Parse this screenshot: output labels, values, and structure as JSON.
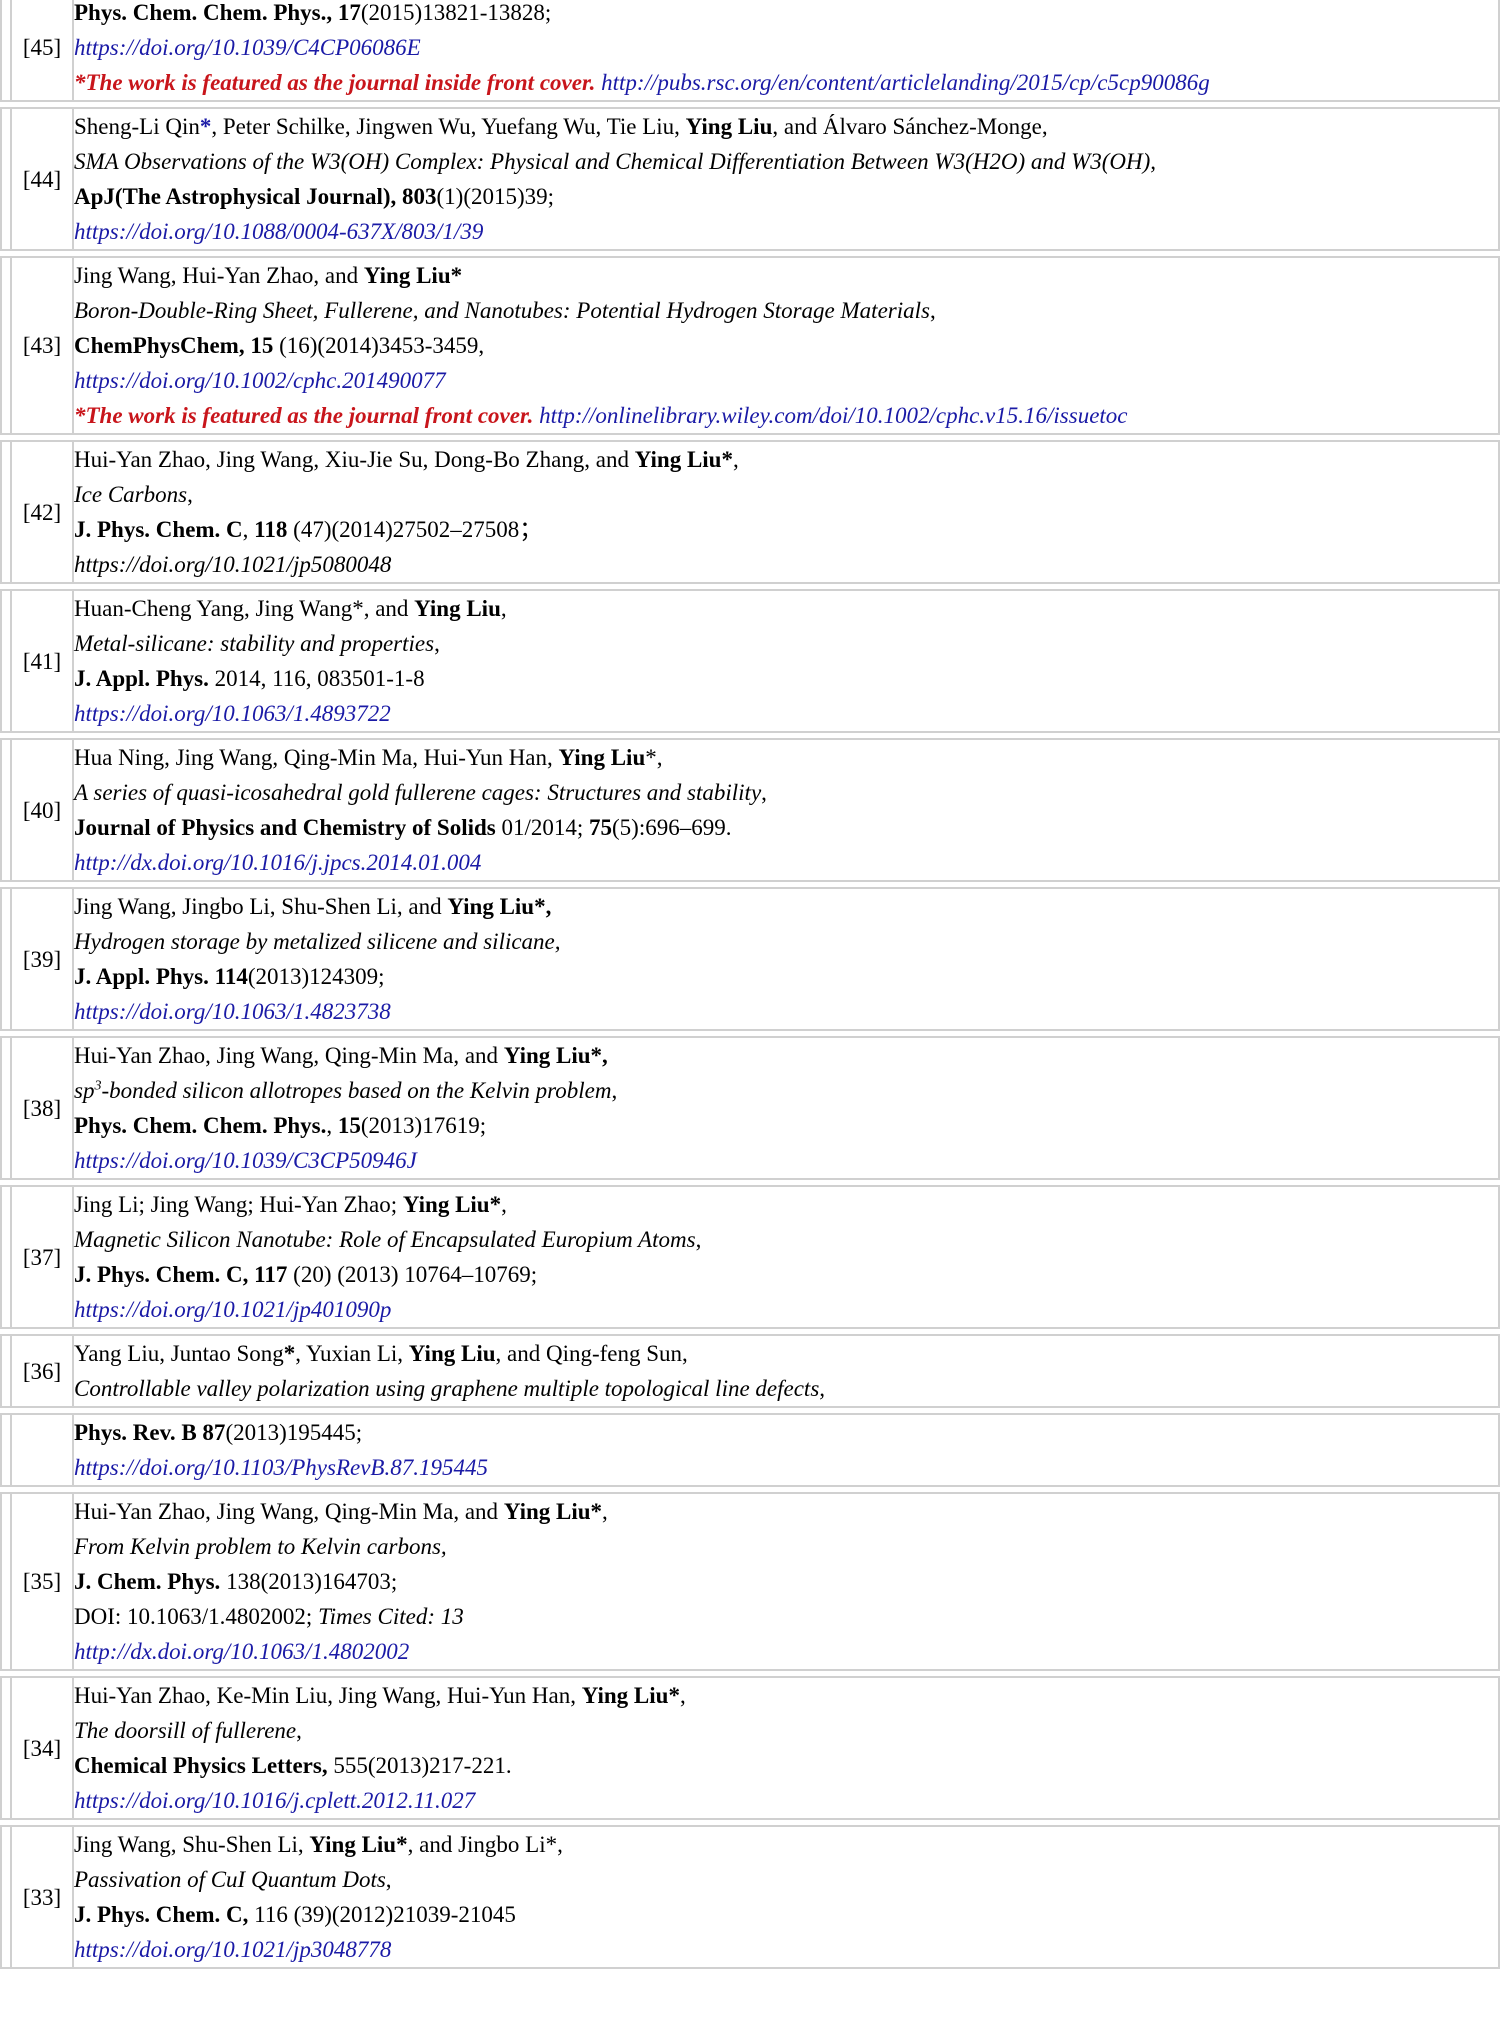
{
  "entries": {
    "e45": {
      "number": "[45]",
      "cut_text": "",
      "journal": "Phys. Chem. Chem. Phys., 17",
      "citation": "(2015)13821-13828;",
      "doi": "https://doi.org/10.1039/C4CP06086E",
      "feature_note": "*The work is featured as the journal inside front cover.",
      "feature_link": "http://pubs.rsc.org/en/content/articlelanding/2015/cp/c5cp90086g"
    },
    "e44": {
      "number": "[44]",
      "authors_pre": "Sheng-Li Qin",
      "authors_star": "*",
      "authors_mid": ", Peter Schilke, Jingwen Wu, Yuefang Wu, Tie Liu, ",
      "highlight": "Ying Liu",
      "authors_post": ", and Álvaro Sánchez-Monge,",
      "title": "SMA Observations of the W3(OH) Complex: Physical and Chemical Differentiation Between W3(H2O) and W3(OH),",
      "journal": "ApJ(The Astrophysical Journal), 803",
      "citation": "(1)(2015)39;",
      "doi": "https://doi.org/10.1088/0004-637X/803/1/39"
    },
    "e43": {
      "number": "[43]",
      "authors": "Jing Wang, Hui-Yan Zhao, and ",
      "highlight": "Ying Liu*",
      "title": "Boron-Double-Ring Sheet, Fullerene, and Nanotubes: Potential Hydrogen Storage Materials",
      "title_tail": ",",
      "journal": "ChemPhysChem, 15",
      "citation": " (16)(2014)3453-3459,",
      "doi": "https://doi.org/10.1002/cphc.201490077",
      "feature_note": "*The work is featured as the journal front cover.",
      "feature_link": "http://onlinelibrary.wiley.com/doi/10.1002/cphc.v15.16/issuetoc"
    },
    "e42": {
      "number": "[42]",
      "authors": "Hui-Yan Zhao, Jing Wang, Xiu-Jie Su, Dong-Bo Zhang, and ",
      "highlight": "Ying Liu*",
      "authors_post": ",",
      "title": "Ice Carbons",
      "title_tail": ",",
      "journal_a": "J. Phys. Chem. C",
      "sep": ", ",
      "journal_b": "118",
      "citation": " (47)(2014)27502–27508；",
      "doi": "https://doi.org/10.1021/jp5080048"
    },
    "e41": {
      "number": "[41]",
      "authors": "Huan-Cheng Yang, Jing Wang*, and ",
      "highlight": "Ying Liu",
      "authors_post": ",",
      "title": "Metal-silicane: stability and properties",
      "title_tail": ",",
      "journal": "J. Appl. Phys.",
      "citation": " 2014, 116, 083501-1-8",
      "doi": "https://doi.org/10.1063/1.4893722"
    },
    "e40": {
      "number": "[40]",
      "authors": "Hua Ning, Jing Wang, Qing-Min Ma, Hui-Yun Han, ",
      "highlight": "Ying Liu",
      "authors_post": "*,",
      "title": "A series of quasi-icosahedral gold fullerene cages: Structures and stability",
      "title_tail": ",",
      "journal": "Journal of Physics and Chemistry of Solids",
      "citation_a": " 01/2014; ",
      "volume": "75",
      "citation_b": "(5):696–699.",
      "doi": "http://dx.doi.org/10.1016/j.jpcs.2014.01.004"
    },
    "e39": {
      "number": "[39]",
      "authors": "Jing Wang, Jingbo Li, Shu-Shen Li, and ",
      "highlight": "Ying Liu*,",
      "title": "Hydrogen storage by metalized silicene and silicane,",
      "journal": "J. Appl. Phys. 114",
      "citation": "(2013)124309;",
      "doi": "https://doi.org/10.1063/1.4823738"
    },
    "e38": {
      "number": "[38]",
      "authors": "Hui-Yan Zhao, Jing Wang, Qing-Min Ma, and ",
      "highlight": "Ying Liu*,",
      "title_a": "sp",
      "title_sup": "3",
      "title_b": "-bonded silicon allotropes based on the Kelvin problem",
      "title_tail": ",",
      "journal": "Phys. Chem. Chem. Phys.",
      "sep": ", ",
      "volume": "15",
      "citation": "(2013)17619;",
      "doi": "https://doi.org/10.1039/C3CP50946J"
    },
    "e37": {
      "number": "[37]",
      "authors": "Jing Li; Jing Wang; Hui-Yan Zhao; ",
      "highlight": "Ying Liu*",
      "authors_post": ",",
      "title": "Magnetic Silicon Nanotube: Role of Encapsulated Europium Atoms",
      "title_tail": ",",
      "journal": "J. Phys. Chem. C, 117",
      "citation": " (20) (2013) 10764–10769;",
      "doi": "https://doi.org/10.1021/jp401090p"
    },
    "e36": {
      "number": "[36]",
      "authors_pre": "Yang Liu, Juntao Song",
      "authors_star": "*",
      "authors_mid": ", Yuxian Li, ",
      "highlight": "Ying Liu",
      "authors_post": ", and Qing-feng Sun,",
      "title": "Controllable valley polarization using graphene multiple topological line defects,"
    },
    "e36b": {
      "number": "",
      "journal": "Phys. Rev. B 87",
      "citation": "(2013)195445;",
      "doi": "https://doi.org/10.1103/PhysRevB.87.195445"
    },
    "e35": {
      "number": "[35]",
      "authors": "Hui-Yan Zhao, Jing Wang, Qing-Min Ma, and ",
      "highlight": "Ying Liu*",
      "authors_post": ",",
      "title": "From Kelvin problem to Kelvin carbons,",
      "journal": "J. Chem. Phys.",
      "citation": " 138(2013)164703;",
      "doi_text": "DOI: 10.1063/1.4802002; ",
      "times_cited": "Times Cited: 13",
      "doi": "http://dx.doi.org/10.1063/1.4802002"
    },
    "e34": {
      "number": "[34]",
      "authors": "Hui-Yan Zhao, Ke-Min Liu, Jing Wang, Hui-Yun Han, ",
      "highlight": "Ying Liu*",
      "authors_post": ",",
      "title": "The doorsill of fullerene",
      "title_tail": ",",
      "journal": "Chemical Physics Letters,",
      "citation": " 555(2013)217-221.",
      "doi": "https://doi.org/10.1016/j.cplett.2012.11.027"
    },
    "e33": {
      "number": "[33]",
      "authors": "Jing Wang, Shu-Shen Li, ",
      "highlight": "Ying Liu*",
      "authors_post": ", and Jingbo Li*,",
      "title": "Passivation of CuI Quantum Dots",
      "title_tail": ",",
      "journal": "J. Phys. Chem. C,",
      "citation": " 116 (39)(2012)21039-21045",
      "doi": "https://doi.org/10.1021/jp3048778"
    }
  }
}
